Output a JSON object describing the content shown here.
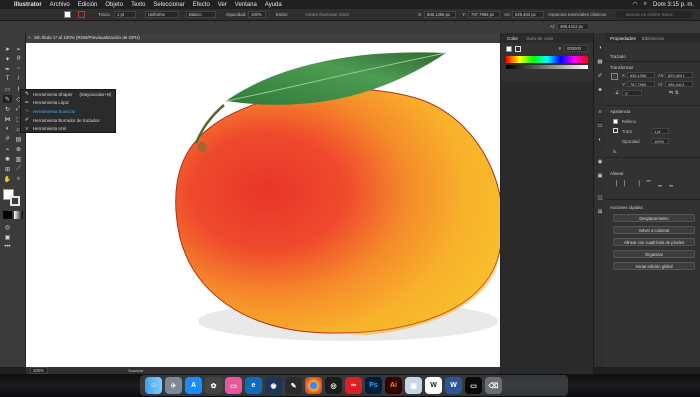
{
  "menubar": {
    "app_name": "Illustrator",
    "items": [
      "Archivo",
      "Edición",
      "Objeto",
      "Texto",
      "Seleccionar",
      "Efecto",
      "Ver",
      "Ventana",
      "Ayuda"
    ],
    "clock": "Dom 3:15 p. m."
  },
  "control_bar": {
    "trazo_label": "Trazo:",
    "trazo_value": "1 pt",
    "uniforme": "Uniforme",
    "basico": "Básico",
    "opacidad_label": "Opacidad:",
    "opacidad_value": "100%",
    "estilo_label": "Estilo:",
    "app_title": "Adobe Illustrator 2020",
    "workspace": "Aspectos esenciales clásicos",
    "stock_search": "Buscar en Adobe Stock"
  },
  "transform_bar": {
    "x_label": "X:",
    "x_value": "636,1356 px",
    "y_label": "Y:",
    "y_value": "767,7965 px",
    "an_label": "An:",
    "an_value": "629,404 px",
    "al_label": "Al:",
    "al_value": "498,4413 px"
  },
  "document_tab": {
    "title": "Sin título-1* al 100% (RGB/Previsualización de GPU)"
  },
  "flyout": {
    "items": [
      {
        "label": "Herramienta Shaper",
        "shortcut": "(Mayúsculas+N)",
        "selected": false
      },
      {
        "label": "Herramienta Lápiz",
        "shortcut": "",
        "selected": false
      },
      {
        "label": "Herramienta Suavizar",
        "shortcut": "",
        "selected": true
      },
      {
        "label": "Herramienta Borrador de trazados",
        "shortcut": "",
        "selected": false
      },
      {
        "label": "Herramienta Unir",
        "shortcut": "",
        "selected": false
      }
    ]
  },
  "color_panel": {
    "tab_color": "Color",
    "tab_guide": "Guía de color",
    "hex_prefix": "#",
    "hex_value": "000000"
  },
  "status_bar": {
    "zoom": "100%",
    "tool": "Suavizar"
  },
  "properties": {
    "tab_props": "Propiedades",
    "tab_libs": "Bibliotecas",
    "trazado": "Trazado",
    "transformar": "Transformar",
    "x_label": "X:",
    "x_value": "636,1356",
    "y_label": "Y:",
    "y_value": "767,7965",
    "an_label": "An:",
    "an_value": "629,404 t",
    "al_label": "Al:",
    "al_value": "498,4413",
    "angle_value": "0°",
    "apariencia": "Apariencia",
    "relleno": "Relleno",
    "trazo": "Trazo",
    "trazo_value": "1 pt",
    "opacidad": "Opacidad",
    "opacidad_value": "100%",
    "fx": "fx.",
    "alinear": "Alinear",
    "acciones": "Acciones rápidas",
    "buttons": [
      "Desplazamiento",
      "Volver a colorear",
      "Alinear con cuadrícula de píxeles",
      "Organizar",
      "Iniciar edición global"
    ]
  },
  "dock": {
    "apps": [
      "Finder",
      "Launchpad",
      "App Store",
      "Photos",
      "Screen",
      "Edge",
      "Recorder",
      "Chrome",
      "Cinema",
      "Creative Cloud",
      "Ps",
      "Ai",
      "Preview",
      "Wikipedia",
      "Word",
      "Keynote",
      "Screenshot",
      "Trash"
    ]
  }
}
